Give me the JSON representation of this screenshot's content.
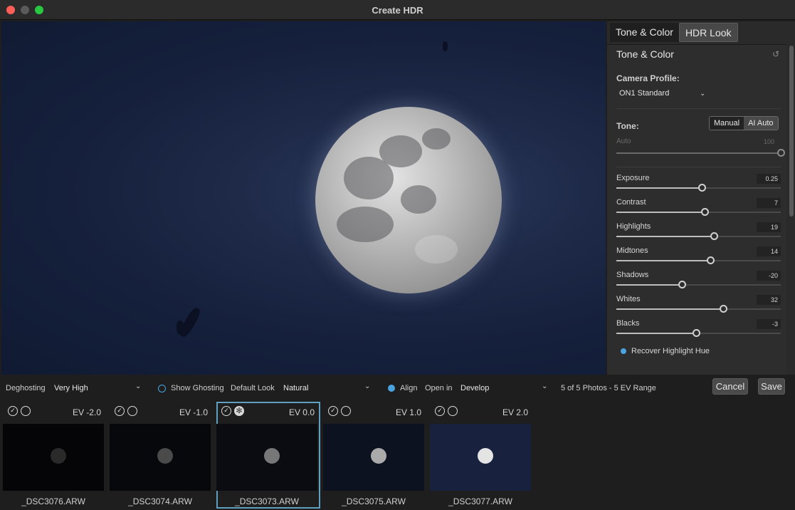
{
  "window": {
    "title": "Create HDR"
  },
  "panel": {
    "tabs": [
      {
        "label": "Tone & Color"
      },
      {
        "label": "HDR Look"
      }
    ],
    "section_title": "Tone & Color",
    "camera_profile_label": "Camera Profile:",
    "camera_profile_value": "ON1 Standard",
    "tone_label": "Tone:",
    "tone_modes": [
      {
        "label": "Manual"
      },
      {
        "label": "AI Auto"
      }
    ],
    "auto_label": "Auto",
    "auto_value": "100",
    "sliders": [
      {
        "label": "Exposure",
        "value": "0.25",
        "pos": 0.52
      },
      {
        "label": "Contrast",
        "value": "7",
        "pos": 0.535
      },
      {
        "label": "Highlights",
        "value": "19",
        "pos": 0.595
      },
      {
        "label": "Midtones",
        "value": "14",
        "pos": 0.57
      },
      {
        "label": "Shadows",
        "value": "-20",
        "pos": 0.4
      },
      {
        "label": "Whites",
        "value": "32",
        "pos": 0.65
      },
      {
        "label": "Blacks",
        "value": "-3",
        "pos": 0.485
      }
    ],
    "recover_highlight_label": "Recover Highlight Hue"
  },
  "options": {
    "deghosting_label": "Deghosting",
    "deghosting_value": "Very High",
    "show_ghosting_label": "Show Ghosting",
    "default_look_label": "Default Look",
    "default_look_value": "Natural",
    "align_label": "Align",
    "open_in_label": "Open in",
    "open_in_value": "Develop",
    "range_info": "5 of 5 Photos - 5 EV Range",
    "cancel_label": "Cancel",
    "save_label": "Save"
  },
  "thumbnails": [
    {
      "ev": "EV -2.0",
      "filename": "_DSC3076.ARW",
      "selected": false
    },
    {
      "ev": "EV -1.0",
      "filename": "_DSC3074.ARW",
      "selected": false
    },
    {
      "ev": "EV 0.0",
      "filename": "_DSC3073.ARW",
      "selected": true
    },
    {
      "ev": "EV 1.0",
      "filename": "_DSC3075.ARW",
      "selected": false
    },
    {
      "ev": "EV 2.0",
      "filename": "_DSC3077.ARW",
      "selected": false
    }
  ],
  "colors": {
    "accent": "#4aa3df",
    "selection": "#5f9fbf"
  }
}
